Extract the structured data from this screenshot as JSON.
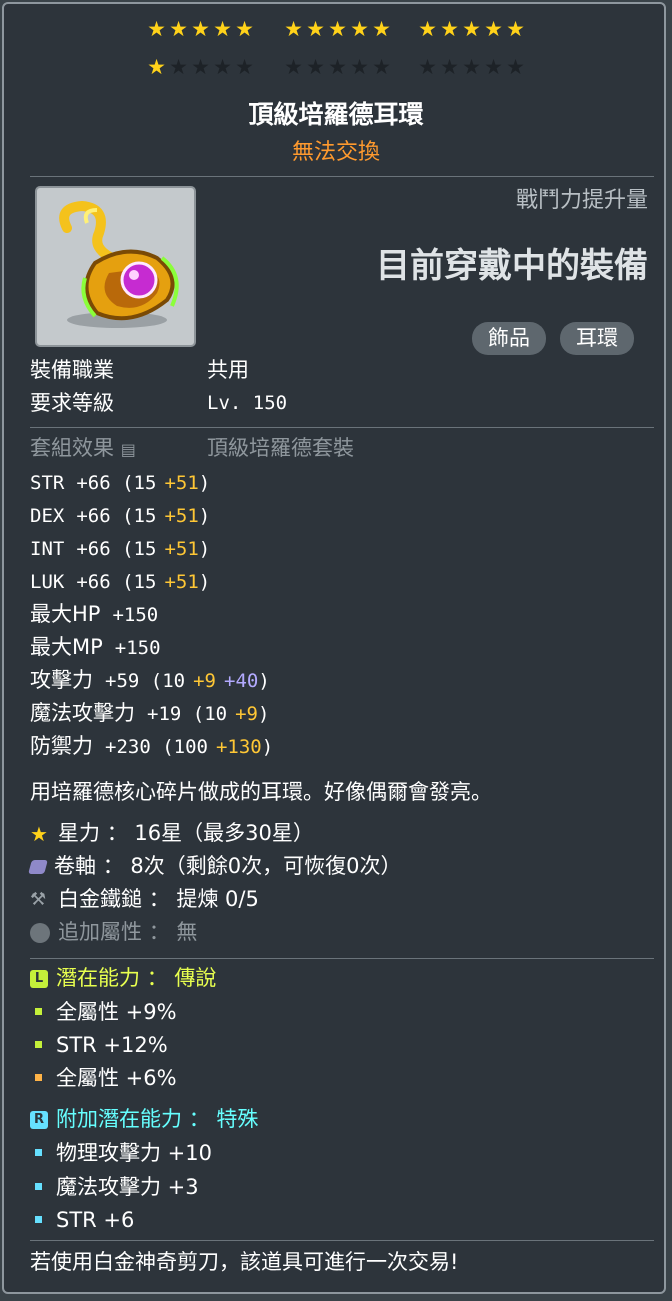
{
  "star_force": {
    "current": 16,
    "max": 30
  },
  "item": {
    "name": "頂級培羅德耳環",
    "tradability": "無法交換",
    "cp_label": "戰鬥力提升量",
    "cp_value": "目前穿戴中的裝備",
    "tags": [
      "飾品",
      "耳環"
    ],
    "job_label": "裝備職業",
    "job_value": "共用",
    "level_label": "要求等級",
    "level_value": "Lv. 150",
    "set_label": "套組效果",
    "set_value": "頂級培羅德套裝"
  },
  "stats": [
    {
      "name": "STR",
      "total": "+66",
      "base": "15",
      "bonus": "+51",
      "extra": ""
    },
    {
      "name": "DEX",
      "total": "+66",
      "base": "15",
      "bonus": "+51",
      "extra": ""
    },
    {
      "name": "INT",
      "total": "+66",
      "base": "15",
      "bonus": "+51",
      "extra": ""
    },
    {
      "name": "LUK",
      "total": "+66",
      "base": "15",
      "bonus": "+51",
      "extra": ""
    },
    {
      "name": "最大HP",
      "total": "+150",
      "base": "",
      "bonus": "",
      "extra": ""
    },
    {
      "name": "最大MP",
      "total": "+150",
      "base": "",
      "bonus": "",
      "extra": ""
    },
    {
      "name": "攻擊力",
      "total": "+59",
      "base": "10",
      "bonus": "+9",
      "extra": "+40"
    },
    {
      "name": "魔法攻擊力",
      "total": "+19",
      "base": "10",
      "bonus": "+9",
      "extra": ""
    },
    {
      "name": "防禦力",
      "total": "+230",
      "base": "100",
      "bonus": "+130",
      "extra": ""
    }
  ],
  "description": "用培羅德核心碎片做成的耳環。好像偶爾會發亮。",
  "enhance": {
    "starforce_label": "星力",
    "starforce_value": "16星（最多30星）",
    "scroll_label": "卷軸",
    "scroll_value": "8次（剩餘0次，可恢復0次）",
    "hammer_label": "白金鐵鎚",
    "hammer_value": "提煉 0/5",
    "flame_label": "追加屬性",
    "flame_value": "無"
  },
  "potential": {
    "badge": "L",
    "label": "潛在能力",
    "grade": "傳說",
    "lines": [
      "全屬性 +9%",
      "STR +12%",
      "全屬性 +6%"
    ]
  },
  "bonus_potential": {
    "badge": "R",
    "label": "附加潛在能力",
    "grade": "特殊",
    "lines": [
      "物理攻擊力 +10",
      "魔法攻擊力 +3",
      "STR +6"
    ]
  },
  "footer": "若使用白金神奇剪刀，該道具可進行一次交易!",
  "colors": {
    "star_on": "#ffd21a",
    "untradable": "#ff9a2e",
    "bonus_yellow": "#ffc735",
    "bonus_purple": "#b3aaff",
    "legendary": "#e8ff4f",
    "unique_cyan": "#66ffff"
  }
}
